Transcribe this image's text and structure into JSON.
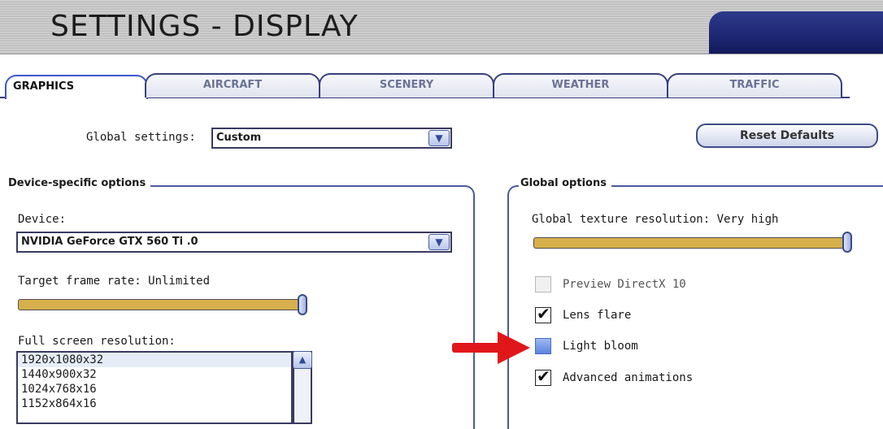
{
  "title": "SETTINGS - DISPLAY",
  "tabs": [
    {
      "label": "GRAPHICS",
      "active": true
    },
    {
      "label": "AIRCRAFT",
      "active": false
    },
    {
      "label": "SCENERY",
      "active": false
    },
    {
      "label": "WEATHER",
      "active": false
    },
    {
      "label": "TRAFFIC",
      "active": false
    }
  ],
  "global_settings": {
    "label": "Global settings:",
    "value": "Custom"
  },
  "reset_button": "Reset Defaults",
  "device_section": {
    "title": "Device-specific options",
    "device_label": "Device:",
    "device_value": "NVIDIA GeForce GTX 560 Ti  .0",
    "frame_rate_label": "Target frame rate: Unlimited",
    "frame_rate_level": 1.0,
    "resolution_label": "Full screen resolution:",
    "resolutions": [
      "1920x1080x32",
      "1440x900x32",
      "1024x768x16",
      "1152x864x16"
    ]
  },
  "global_section": {
    "title": "Global options",
    "texture_label": "Global texture resolution: Very high",
    "texture_level": 1.0,
    "options": [
      {
        "label": "Preview DirectX 10",
        "checked": false,
        "disabled": true
      },
      {
        "label": "Lens flare",
        "checked": true,
        "disabled": false
      },
      {
        "label": "Light bloom",
        "checked": false,
        "disabled": false
      },
      {
        "label": "Advanced animations",
        "checked": true,
        "disabled": false
      }
    ]
  },
  "colors": {
    "accent": "#1d2672",
    "frame": "#4b5aa0",
    "arrow": "#e0171a"
  },
  "icons": {
    "dropdown": "chevron-down-icon",
    "scroll_up": "arrow-up-icon",
    "check": "check-icon",
    "annotation": "red-arrow"
  }
}
